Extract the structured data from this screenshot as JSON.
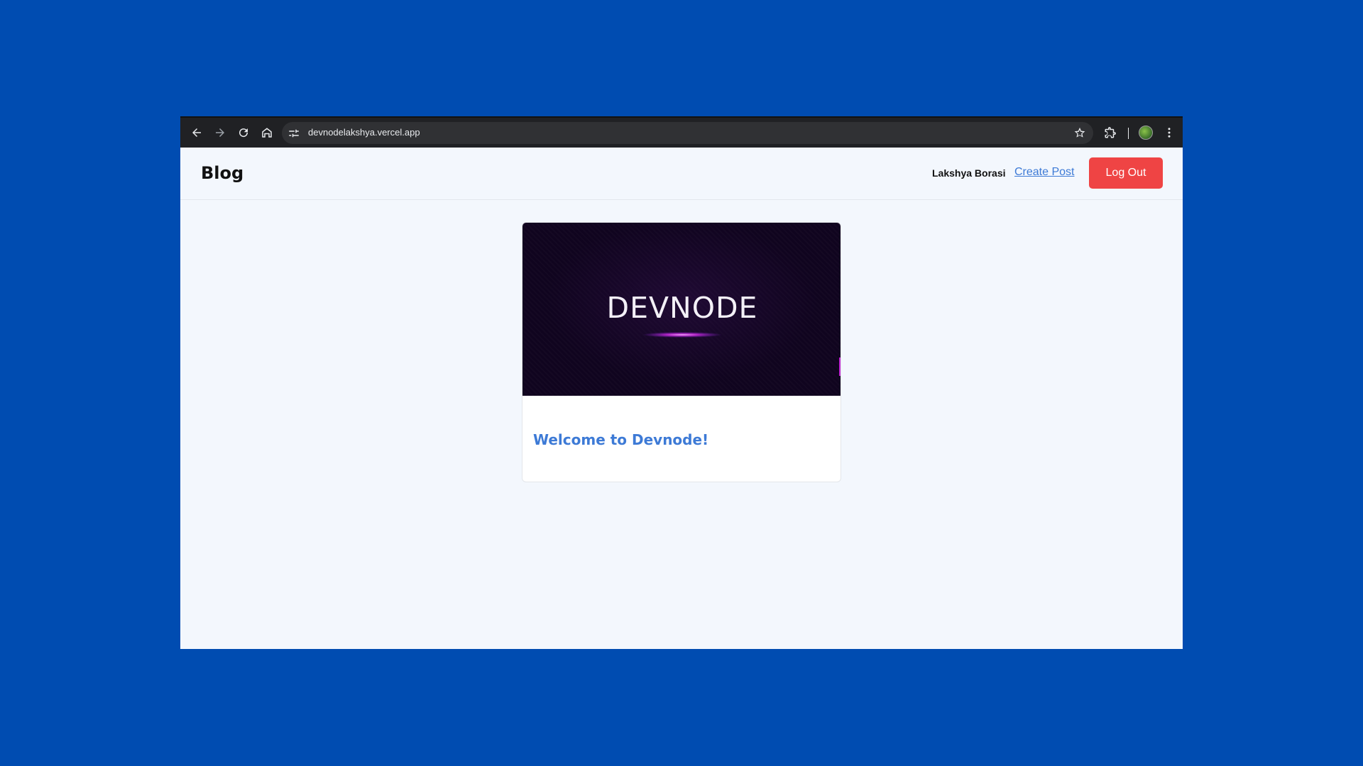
{
  "browser": {
    "url": "devnodelakshya.vercel.app",
    "icons": {
      "back": "arrow-left-icon",
      "forward": "arrow-right-icon",
      "reload": "reload-icon",
      "home": "home-icon",
      "site_info": "tune-icon",
      "bookmark": "star-icon",
      "extensions": "puzzle-icon",
      "profile": "avatar",
      "menu": "kebab-menu-icon"
    }
  },
  "header": {
    "logo": "Blog",
    "username": "Lakshya Borasi",
    "create_post_label": "Create Post",
    "logout_label": "Log Out"
  },
  "posts": [
    {
      "image_text": "DEVNODE",
      "title": "Welcome to Devnode!"
    }
  ],
  "colors": {
    "background": "#004cb1",
    "page": "#f3f7fd",
    "accent": "#3d7ad6",
    "logout": "#ef4444"
  }
}
